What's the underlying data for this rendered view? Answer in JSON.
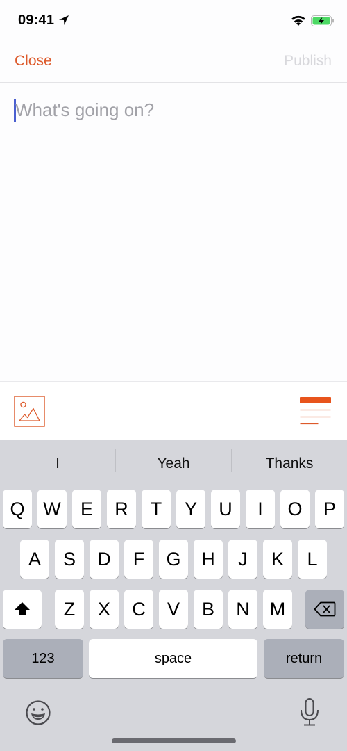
{
  "status_bar": {
    "time": "09:41",
    "icons": [
      "location-arrow-icon",
      "wifi-icon",
      "battery-charging-icon"
    ],
    "battery_color": "#4cd964"
  },
  "nav": {
    "close_label": "Close",
    "publish_label": "Publish",
    "accent_color": "#dd5a2b",
    "publish_enabled": false
  },
  "composer": {
    "value": "",
    "placeholder": "What's going on?",
    "caret_color": "#4a5fd0"
  },
  "toolbar": {
    "image_button": "image-icon",
    "format_button": "text-format-icon"
  },
  "keyboard": {
    "suggestions": [
      "I",
      "Yeah",
      "Thanks"
    ],
    "rows": [
      [
        "Q",
        "W",
        "E",
        "R",
        "T",
        "Y",
        "U",
        "I",
        "O",
        "P"
      ],
      [
        "A",
        "S",
        "D",
        "F",
        "G",
        "H",
        "J",
        "K",
        "L"
      ],
      [
        "Z",
        "X",
        "C",
        "V",
        "B",
        "N",
        "M"
      ]
    ],
    "shift_icon": "shift-icon",
    "delete_icon": "delete-icon",
    "numbers_label": "123",
    "space_label": "space",
    "return_label": "return",
    "emoji_icon": "emoji-icon",
    "mic_icon": "microphone-icon"
  }
}
